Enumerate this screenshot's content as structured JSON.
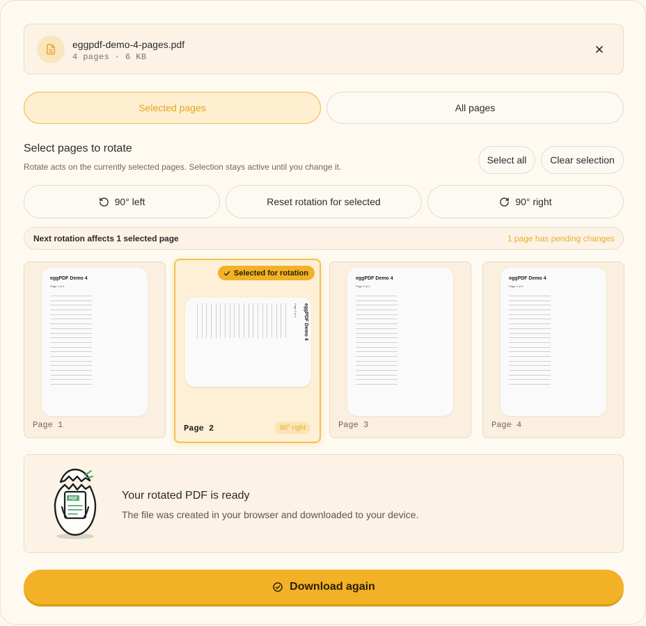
{
  "file": {
    "name": "eggpdf-demo-4-pages.pdf",
    "meta": "4 pages · 6 KB"
  },
  "tabs": [
    {
      "label": "Selected pages",
      "active": true
    },
    {
      "label": "All pages",
      "active": false
    }
  ],
  "selection": {
    "title": "Select pages to rotate",
    "description": "Rotate acts on the currently selected pages. Selection stays active until you change it.",
    "select_all_label": "Select all",
    "clear_label": "Clear selection"
  },
  "actions": {
    "rotate_left_label": "90° left",
    "reset_label": "Reset rotation for selected",
    "rotate_right_label": "90° right"
  },
  "status": {
    "left": "Next rotation affects 1 selected page",
    "right": "1 page has pending changes"
  },
  "pages": [
    {
      "label": "Page 1",
      "thumb_title": "eggPDF Demo 4",
      "thumb_sub": "Page 1 of 4",
      "selected": false
    },
    {
      "label": "Page 2",
      "thumb_title": "eggPDF Demo 4",
      "thumb_sub": "Page 2 of 4",
      "selected": true,
      "badge": "Selected for rotation",
      "rotation": "90° right"
    },
    {
      "label": "Page 3",
      "thumb_title": "eggPDF Demo 4",
      "thumb_sub": "Page 3 of 4",
      "selected": false
    },
    {
      "label": "Page 4",
      "thumb_title": "eggPDF Demo 4",
      "thumb_sub": "Page 4 of 4",
      "selected": false
    }
  ],
  "ready": {
    "title": "Your rotated PDF is ready",
    "description": "The file was created in your browser and downloaded to your device.",
    "egg_badge": "PDF"
  },
  "download_label": "Download again",
  "colors": {
    "accent": "#f2b126",
    "accent_text": "#e7a320",
    "background": "#fefaf1"
  },
  "icons": {
    "file": "document-icon",
    "close": "close-icon",
    "rotate_left": "rotate-ccw-icon",
    "rotate_right": "rotate-cw-icon",
    "check": "check-icon",
    "download": "check-circle-icon"
  }
}
